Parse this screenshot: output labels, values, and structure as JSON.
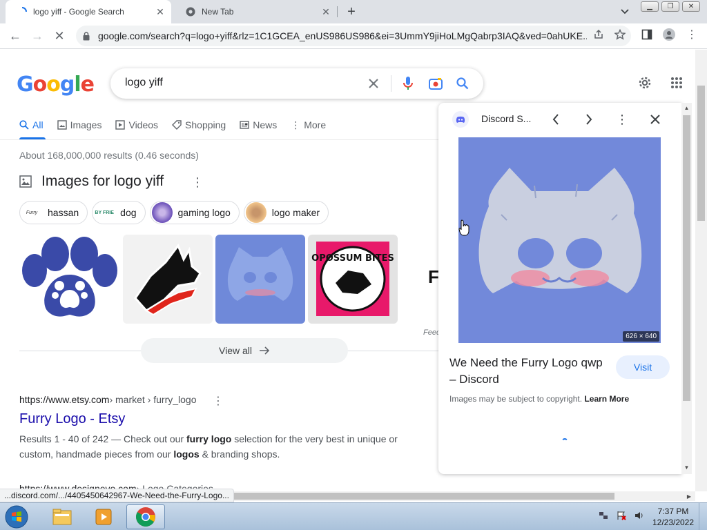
{
  "browser": {
    "tabs": [
      {
        "title": "logo yiff - Google Search",
        "active": true
      },
      {
        "title": "New Tab",
        "active": false
      }
    ],
    "url": "google.com/search?q=logo+yiff&rlz=1C1GCEA_enUS986US986&ei=3UmmY9jiHoLMgQabrp3IAQ&ved=0ahUKE...",
    "status_url": "...discord.com/.../4405450642967-We-Need-the-Furry-Logo..."
  },
  "google": {
    "logo_letters": [
      "G",
      "o",
      "o",
      "g",
      "l",
      "e"
    ],
    "logo_colors": [
      "#4285f4",
      "#ea4335",
      "#fbbc05",
      "#4285f4",
      "#34a853",
      "#ea4335"
    ],
    "query": "logo yiff",
    "tabs": [
      {
        "label": "All",
        "icon": "search-icon"
      },
      {
        "label": "Images",
        "icon": "image-icon"
      },
      {
        "label": "Videos",
        "icon": "play-icon"
      },
      {
        "label": "Shopping",
        "icon": "tag-icon"
      },
      {
        "label": "News",
        "icon": "news-icon"
      },
      {
        "label": "More",
        "icon": "more-vert-icon"
      }
    ],
    "stats": "About 168,000,000 results (0.46 seconds)"
  },
  "images_section": {
    "heading": "Images for logo yiff",
    "chips": [
      {
        "label": "hassan",
        "thumb_text": "Furry"
      },
      {
        "label": "dog",
        "thumb_text": "BY FRIE"
      },
      {
        "label": "gaming logo",
        "thumb_text": ""
      },
      {
        "label": "logo maker",
        "thumb_text": ""
      }
    ],
    "thumb_partial_text": "Fu",
    "opossum_text": "OPOSSUM BITES",
    "feedback": "Feed",
    "view_all": "View all"
  },
  "results": [
    {
      "url_host": "https://www.etsy.com",
      "url_crumbs": " › market › furry_logo",
      "title": "Furry Logo - Etsy",
      "snippet_pre": "Results 1 - 40 of 242 — Check out our ",
      "snippet_b1": "furry logo",
      "snippet_mid": " selection for the very best in unique or custom, handmade pieces from our ",
      "snippet_b2": "logos",
      "snippet_post": " & branding shops."
    },
    {
      "url_host": "https://www.designevo.com",
      "url_crumbs": " › Logo Categories"
    }
  ],
  "side_panel": {
    "site": "Discord S...",
    "image_dims": "626 × 640",
    "title": "We Need the Furry Logo qwp – Discord",
    "visit": "Visit",
    "copyright_text": "Images may be subject to copyright. ",
    "learn_more": "Learn More"
  },
  "taskbar": {
    "time": "7:37 PM",
    "date": "12/23/2022"
  }
}
